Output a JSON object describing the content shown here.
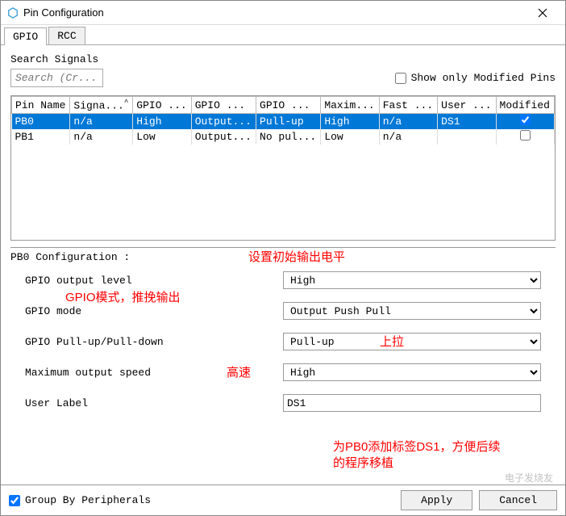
{
  "window": {
    "title": "Pin Configuration"
  },
  "tabs": {
    "gpio": "GPIO",
    "rcc": "RCC"
  },
  "search": {
    "label": "Search Signals",
    "placeholder": "Search (Cr...",
    "show_modified_label": "Show only Modified Pins"
  },
  "table": {
    "headers": {
      "pin_name": "Pin Name",
      "signal": "Signa...",
      "gpio_out": "GPIO ...",
      "gpio_mode": "GPIO ...",
      "gpio_pull": "GPIO ...",
      "max_speed": "Maxim...",
      "fast": "Fast ...",
      "user": "User ...",
      "modified": "Modified"
    },
    "rows": [
      {
        "pin_name": "PB0",
        "signal": "n/a",
        "gpio_out": "High",
        "gpio_mode": "Output...",
        "gpio_pull": "Pull-up",
        "max_speed": "High",
        "fast": "n/a",
        "user": "DS1",
        "modified": true,
        "selected": true
      },
      {
        "pin_name": "PB1",
        "signal": "n/a",
        "gpio_out": "Low",
        "gpio_mode": "Output...",
        "gpio_pull": "No pul...",
        "max_speed": "Low",
        "fast": "n/a",
        "user": "",
        "modified": false,
        "selected": false
      }
    ]
  },
  "config": {
    "title": "PB0 Configuration :",
    "fields": {
      "output_level": {
        "label": "GPIO output level",
        "value": "High"
      },
      "mode": {
        "label": "GPIO mode",
        "value": "Output Push Pull"
      },
      "pull": {
        "label": "GPIO Pull-up/Pull-down",
        "value": "Pull-up"
      },
      "speed": {
        "label": "Maximum output speed",
        "value": "High"
      },
      "user_label": {
        "label": "User Label",
        "value": "DS1"
      }
    }
  },
  "annotations": {
    "a1": "设置初始输出电平",
    "a2": "GPIO模式，推挽输出",
    "a3": "上拉",
    "a4": "高速",
    "a5_line1": "为PB0添加标签DS1，方便后续",
    "a5_line2": "的程序移植"
  },
  "footer": {
    "group_label": "Group By Peripherals",
    "apply": "Apply",
    "cancel": "Cancel"
  },
  "watermark": "电子发烧友"
}
